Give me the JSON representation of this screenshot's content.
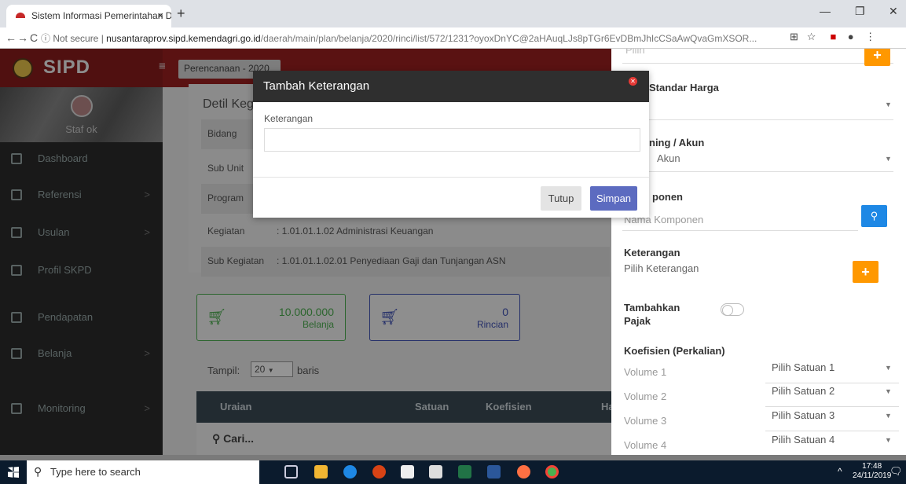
{
  "browser": {
    "tab_title": "Sistem Informasi Pemerintahan D",
    "tab_close": "×",
    "new_tab": "+",
    "url_prefix": "ⓘ Not secure  |  ",
    "url_host": "nusantaraprov.sipd.kemendagri.go.id",
    "url_path": "/daerah/main/plan/belanja/2020/rinci/list/572/1231?oyoxDnYC@2aHAuqLJs8pTGr6EvDBmJhIcCSaAwQvaGmXSOR..."
  },
  "sidebar": {
    "brand": "SIPD",
    "user": "Staf ok",
    "items": [
      {
        "label": "Dashboard",
        "chevron": ""
      },
      {
        "label": "Referensi",
        "chevron": ">"
      },
      {
        "label": "Usulan",
        "chevron": ">"
      },
      {
        "label": "Profil SKPD",
        "chevron": ""
      },
      {
        "label": "Pendapatan",
        "chevron": ""
      },
      {
        "label": "Belanja",
        "chevron": ">"
      },
      {
        "label": "Monitoring",
        "chevron": ">"
      }
    ]
  },
  "topbar": {
    "breadcrumb": "Perencanaan - 2020"
  },
  "detail": {
    "title": "Detil Keg",
    "rows": [
      {
        "label": "Bidang",
        "value": ""
      },
      {
        "label": "Sub Unit",
        "value": ""
      },
      {
        "label": "Program",
        "value": ""
      },
      {
        "label": "Kegiatan",
        "value": ":  1.01.01.1.02 Administrasi Keuangan"
      },
      {
        "label": "Sub Kegiatan",
        "value": ":  1.01.01.1.02.01  Penyediaan Gaji dan Tunjangan ASN"
      }
    ]
  },
  "stats": [
    {
      "value": "10.000.000",
      "label": "Belanja",
      "color": "#4caf50"
    },
    {
      "value": "0",
      "label": "Rincian",
      "color": "#3f51b5"
    }
  ],
  "table": {
    "show_label": "Tampil:",
    "show_value": "20",
    "show_suffix": "baris",
    "headers": [
      "Uraian",
      "Satuan",
      "Koefisien",
      "Ha"
    ],
    "search_placeholder": "Cari..."
  },
  "panel": {
    "top_partial": "Pilih",
    "standar_harga_label": "Standar Harga",
    "akun_label": "ning / Akun",
    "akun_value": "Akun",
    "komponen_label": "ponen",
    "komponen_placeholder": "Nama Komponen",
    "keterangan_label": "Keterangan",
    "keterangan_value": "Pilih Keterangan",
    "pajak_label_1": "Tambahkan",
    "pajak_label_2": "Pajak",
    "koefisien_label": "Koefisien (Perkalian)",
    "volumes": [
      "Volume 1",
      "Volume 2",
      "Volume 3",
      "Volume 4"
    ],
    "satuan": [
      "Pilih Satuan 1",
      "Pilih Satuan 2",
      "Pilih Satuan 3",
      "Pilih Satuan 4"
    ]
  },
  "modal": {
    "title": "Tambah Keterangan",
    "field_label": "Keterangan",
    "field_value": "",
    "cancel_label": "Tutup",
    "save_label": "Simpan"
  },
  "taskbar": {
    "search_placeholder": "Type here to search",
    "time": "17:48",
    "date": "24/11/2019"
  }
}
